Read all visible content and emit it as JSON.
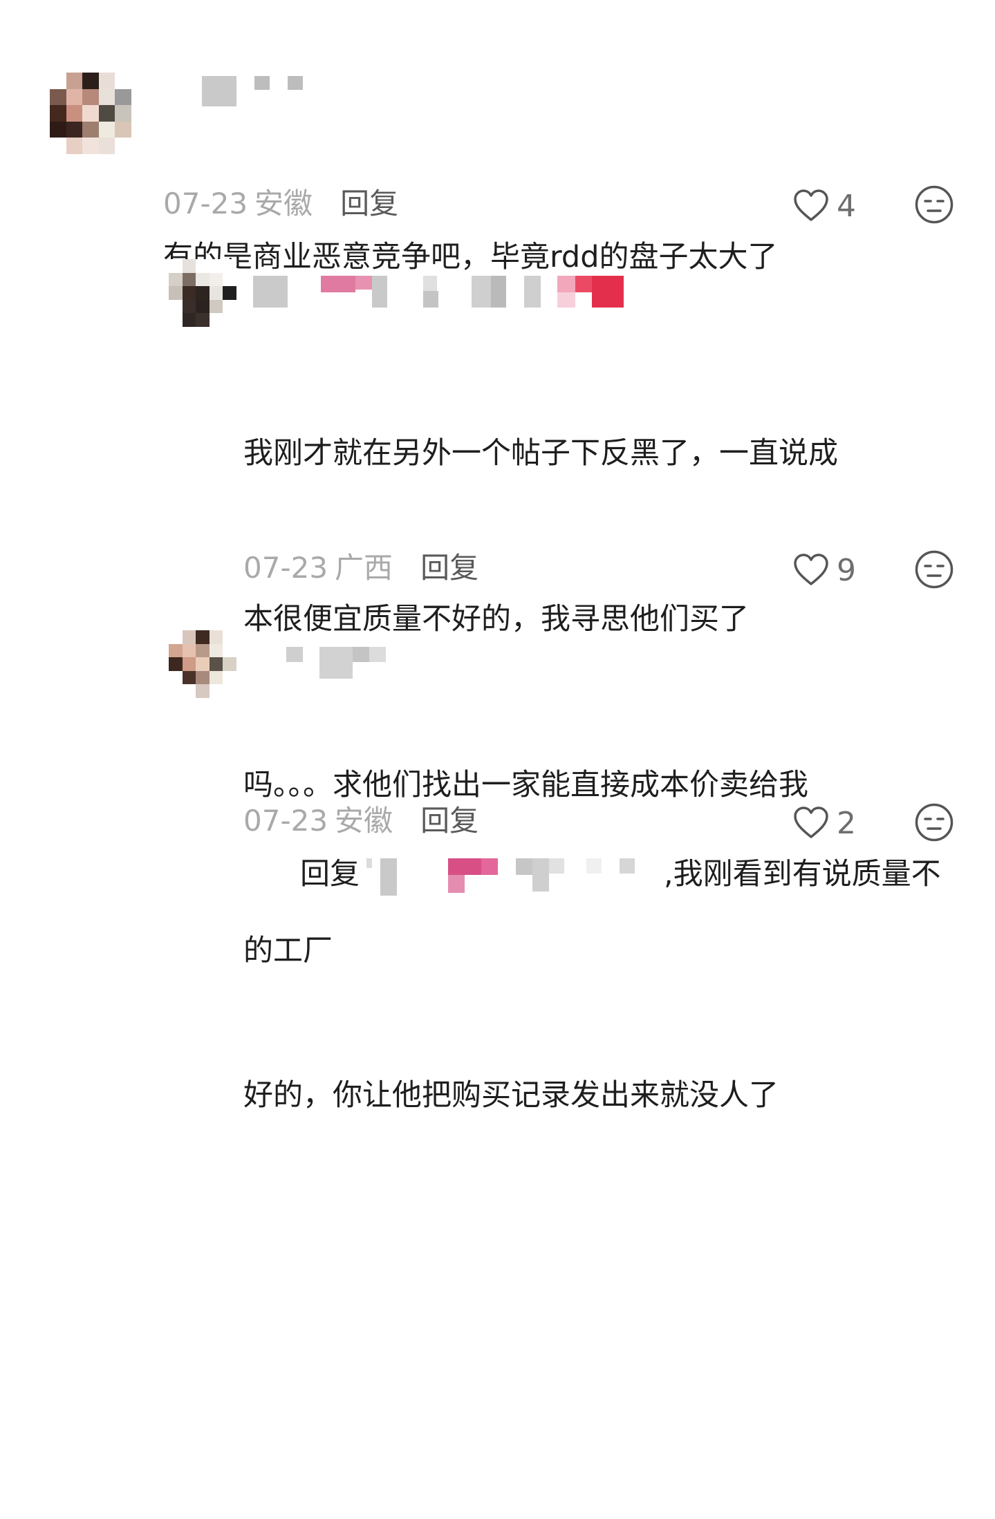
{
  "comments": [
    {
      "text_lines": [
        "有的是商业恶意竞争吧，毕竟rdd的盘子太大了"
      ],
      "date": "07-23",
      "location": "安徽",
      "reply_label": "回复",
      "likes": "4"
    },
    {
      "text_lines": [
        "我刚才就在另外一个帖子下反黑了，一直说成",
        "本很便宜质量不好的，我寻思他们买了",
        "吗。。。求他们找出一家能直接成本价卖给我",
        "的工厂"
      ],
      "date": "07-23",
      "location": "广西",
      "reply_label": "回复",
      "likes": "9"
    },
    {
      "reply_prefix": "回复",
      "text_after_name": ",我刚看到有说质量不",
      "text_lines": [
        "好的，你让他把购买记录发出来就没人了"
      ],
      "date": "07-23",
      "location": "安徽",
      "reply_label": "回复",
      "likes": "2"
    }
  ],
  "icons": {
    "like": "heart-outline-icon",
    "emoji": "neutral-face-icon"
  },
  "colors": {
    "meta_gray": "#a9a9a9",
    "reply_gray": "#5a5a5a",
    "text": "#1e1e1e",
    "blur_pink": "#e05d8f",
    "blur_red": "#e8334f"
  }
}
